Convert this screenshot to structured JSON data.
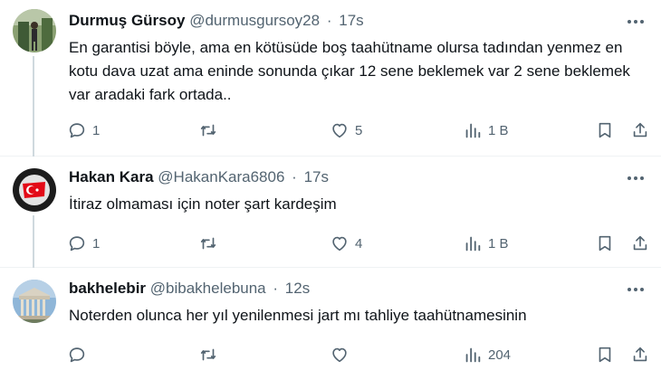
{
  "tweets": [
    {
      "name": "Durmuş Gürsoy",
      "handle": "@durmusgursoy28",
      "dot": "·",
      "time": "17s",
      "text": "En garantisi böyle, ama en kötüsüde boş taahütname olursa tadından yenmez en kotu dava uzat ama eninde sonunda çıkar 12 sene beklemek var 2 sene beklemek var aradaki fark ortada..",
      "replies": "1",
      "retweets": "",
      "likes": "5",
      "views": "1 B"
    },
    {
      "name": "Hakan Kara",
      "handle": "@HakanKara6806",
      "dot": "·",
      "time": "17s",
      "text": "İtiraz olmaması için noter şart kardeşim",
      "replies": "1",
      "retweets": "",
      "likes": "4",
      "views": "1 B"
    },
    {
      "name": "bakhelebir",
      "handle": "@bibakhelebuna",
      "dot": "·",
      "time": "12s",
      "text": "Noterden olunca her yıl yenilenmesi jart mı tahliye taahütnamesinin",
      "replies": "",
      "retweets": "",
      "likes": "",
      "views": "204"
    }
  ],
  "colors": {
    "text": "#0f1419",
    "secondary": "#536471",
    "divider": "#eff3f4",
    "connector": "#cfd9de"
  },
  "icons": [
    "reply-icon",
    "retweet-icon",
    "like-icon",
    "views-icon",
    "bookmark-icon",
    "share-icon",
    "more-icon"
  ]
}
